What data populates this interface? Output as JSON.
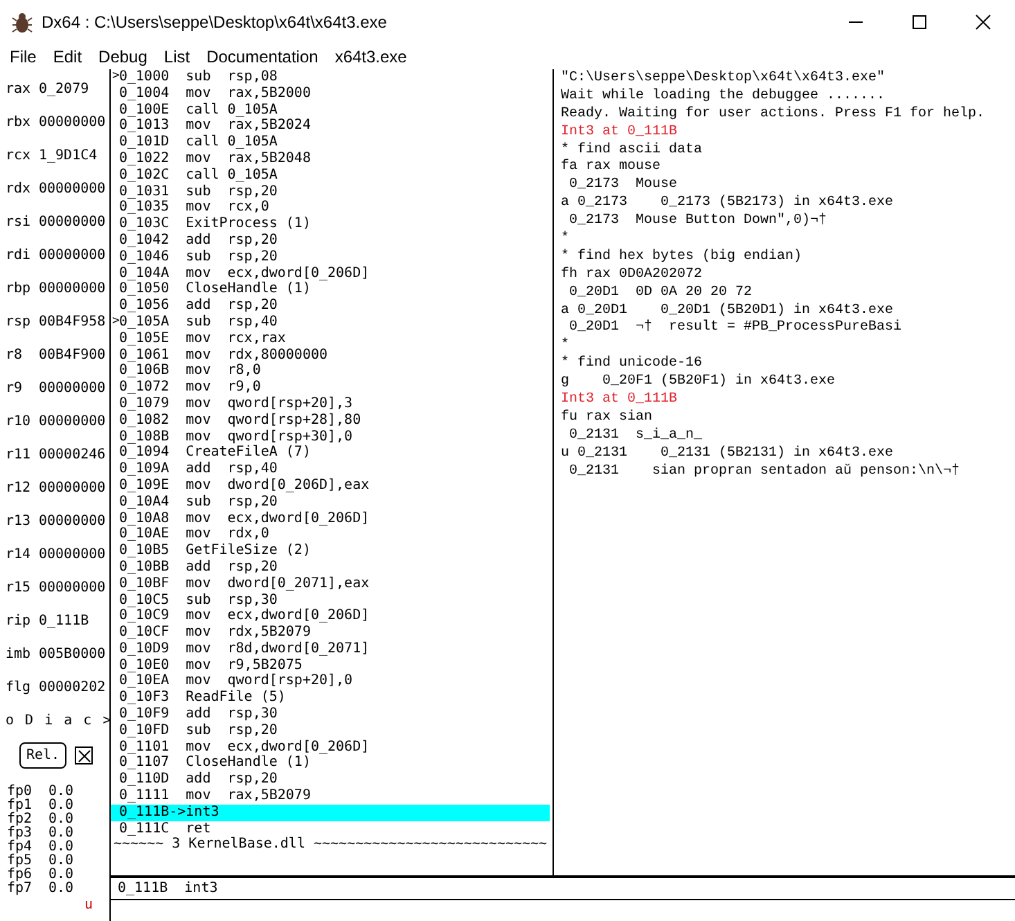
{
  "window": {
    "title": "Dx64 : C:\\Users\\seppe\\Desktop\\x64t\\x64t3.exe"
  },
  "menu": [
    "File",
    "Edit",
    "Debug",
    "List",
    "Documentation",
    "x64t3.exe"
  ],
  "registers": [
    {
      "name": "rax",
      "value": "0_2079"
    },
    {
      "name": "rbx",
      "value": "00000000"
    },
    {
      "name": "rcx",
      "value": "1_9D1C4"
    },
    {
      "name": "rdx",
      "value": "00000000"
    },
    {
      "name": "rsi",
      "value": "00000000"
    },
    {
      "name": "rdi",
      "value": "00000000"
    },
    {
      "name": "rbp",
      "value": "00000000"
    },
    {
      "name": "rsp",
      "value": "00B4F958"
    },
    {
      "name": "r8",
      "value": "00B4F900"
    },
    {
      "name": "r9",
      "value": "00000000"
    },
    {
      "name": "r10",
      "value": "00000000"
    },
    {
      "name": "r11",
      "value": "00000246"
    },
    {
      "name": "r12",
      "value": "00000000"
    },
    {
      "name": "r13",
      "value": "00000000"
    },
    {
      "name": "r14",
      "value": "00000000"
    },
    {
      "name": "r15",
      "value": "00000000"
    },
    {
      "name": "rip",
      "value": "0_111B"
    },
    {
      "name": "imb",
      "value": "005B0000"
    },
    {
      "name": "flg",
      "value": "00000202"
    }
  ],
  "flags": "o D i a c >",
  "rel_button": {
    "label": "Rel.",
    "checked": true
  },
  "fpu": [
    {
      "name": "fp0",
      "value": "0.0"
    },
    {
      "name": "fp1",
      "value": "0.0"
    },
    {
      "name": "fp2",
      "value": "0.0"
    },
    {
      "name": "fp3",
      "value": "0.0"
    },
    {
      "name": "fp4",
      "value": "0.0"
    },
    {
      "name": "fp5",
      "value": "0.0"
    },
    {
      "name": "fp6",
      "value": "0.0"
    },
    {
      "name": "fp7",
      "value": "0.0"
    }
  ],
  "mode_indicator": "u",
  "disassembly": [
    {
      "kind": "instr",
      "marker": ">",
      "text": "0_1000  sub  rsp,08",
      "selected": false
    },
    {
      "kind": "instr",
      "text": "0_1004  mov  rax,5B2000",
      "selected": false
    },
    {
      "kind": "instr",
      "text": "0_100E  call 0_105A",
      "selected": false
    },
    {
      "kind": "instr",
      "text": "0_1013  mov  rax,5B2024",
      "selected": false
    },
    {
      "kind": "instr",
      "text": "0_101D  call 0_105A",
      "selected": false
    },
    {
      "kind": "instr",
      "text": "0_1022  mov  rax,5B2048",
      "selected": false
    },
    {
      "kind": "instr",
      "text": "0_102C  call 0_105A",
      "selected": false
    },
    {
      "kind": "instr",
      "text": "0_1031  sub  rsp,20",
      "selected": false
    },
    {
      "kind": "instr",
      "text": "0_1035  mov  rcx,0",
      "selected": false
    },
    {
      "kind": "instr",
      "text": "0_103C  ExitProcess (1)",
      "selected": false
    },
    {
      "kind": "instr",
      "text": "0_1042  add  rsp,20",
      "selected": false
    },
    {
      "kind": "instr",
      "text": "0_1046  sub  rsp,20",
      "selected": false
    },
    {
      "kind": "instr",
      "text": "0_104A  mov  ecx,dword[0_206D]",
      "selected": false
    },
    {
      "kind": "instr",
      "text": "0_1050  CloseHandle (1)",
      "selected": false
    },
    {
      "kind": "instr",
      "text": "0_1056  add  rsp,20",
      "selected": false
    },
    {
      "kind": "instr",
      "marker": ">",
      "text": "0_105A  sub  rsp,40",
      "selected": false
    },
    {
      "kind": "instr",
      "text": "0_105E  mov  rcx,rax",
      "selected": false
    },
    {
      "kind": "instr",
      "text": "0_1061  mov  rdx,80000000",
      "selected": false
    },
    {
      "kind": "instr",
      "text": "0_106B  mov  r8,0",
      "selected": false
    },
    {
      "kind": "instr",
      "text": "0_1072  mov  r9,0",
      "selected": false
    },
    {
      "kind": "instr",
      "text": "0_1079  mov  qword[rsp+20],3",
      "selected": false
    },
    {
      "kind": "instr",
      "text": "0_1082  mov  qword[rsp+28],80",
      "selected": false
    },
    {
      "kind": "instr",
      "text": "0_108B  mov  qword[rsp+30],0",
      "selected": false
    },
    {
      "kind": "instr",
      "text": "0_1094  CreateFileA (7)",
      "selected": false
    },
    {
      "kind": "instr",
      "text": "0_109A  add  rsp,40",
      "selected": false
    },
    {
      "kind": "instr",
      "text": "0_109E  mov  dword[0_206D],eax",
      "selected": false
    },
    {
      "kind": "instr",
      "text": "0_10A4  sub  rsp,20",
      "selected": false
    },
    {
      "kind": "instr",
      "text": "0_10A8  mov  ecx,dword[0_206D]",
      "selected": false
    },
    {
      "kind": "instr",
      "text": "0_10AE  mov  rdx,0",
      "selected": false
    },
    {
      "kind": "instr",
      "text": "0_10B5  GetFileSize (2)",
      "selected": false
    },
    {
      "kind": "instr",
      "text": "0_10BB  add  rsp,20",
      "selected": false
    },
    {
      "kind": "instr",
      "text": "0_10BF  mov  dword[0_2071],eax",
      "selected": false
    },
    {
      "kind": "instr",
      "text": "0_10C5  sub  rsp,30",
      "selected": false
    },
    {
      "kind": "instr",
      "text": "0_10C9  mov  ecx,dword[0_206D]",
      "selected": false
    },
    {
      "kind": "instr",
      "text": "0_10CF  mov  rdx,5B2079",
      "selected": false
    },
    {
      "kind": "instr",
      "text": "0_10D9  mov  r8d,dword[0_2071]",
      "selected": false
    },
    {
      "kind": "instr",
      "text": "0_10E0  mov  r9,5B2075",
      "selected": false
    },
    {
      "kind": "instr",
      "text": "0_10EA  mov  qword[rsp+20],0",
      "selected": false
    },
    {
      "kind": "instr",
      "text": "0_10F3  ReadFile (5)",
      "selected": false
    },
    {
      "kind": "instr",
      "text": "0_10F9  add  rsp,30",
      "selected": false
    },
    {
      "kind": "instr",
      "text": "0_10FD  sub  rsp,20",
      "selected": false
    },
    {
      "kind": "instr",
      "text": "0_1101  mov  ecx,dword[0_206D]",
      "selected": false
    },
    {
      "kind": "instr",
      "text": "0_1107  CloseHandle (1)",
      "selected": false
    },
    {
      "kind": "instr",
      "text": "0_110D  add  rsp,20",
      "selected": false
    },
    {
      "kind": "instr",
      "text": "0_1111  mov  rax,5B2079",
      "selected": false
    },
    {
      "kind": "instr",
      "text": "0_111B->int3",
      "selected": true
    },
    {
      "kind": "instr",
      "text": "0_111C  ret",
      "selected": false
    },
    {
      "kind": "separator",
      "text": "~~~~~~ 3 KernelBase.dll ~~~~~~~~~~~~~~~~~~~~~~~~~~~~"
    }
  ],
  "console": [
    {
      "kind": "output",
      "text": "\"C:\\Users\\seppe\\Desktop\\x64t\\x64t3.exe\""
    },
    {
      "kind": "output",
      "text": "Wait while loading the debuggee ......."
    },
    {
      "kind": "output",
      "text": "Ready. Waiting for user actions. Press F1 for help."
    },
    {
      "kind": "event",
      "text": "Int3 at 0_111B"
    },
    {
      "kind": "output",
      "text": "* find ascii data"
    },
    {
      "kind": "output",
      "text": "fa rax mouse"
    },
    {
      "kind": "output",
      "text": " 0_2173  Mouse"
    },
    {
      "kind": "output",
      "text": "a 0_2173    0_2173 (5B2173) in x64t3.exe"
    },
    {
      "kind": "output",
      "text": " 0_2173  Mouse Button Down\",0)¬†"
    },
    {
      "kind": "output",
      "text": "*"
    },
    {
      "kind": "output",
      "text": "* find hex bytes (big endian)"
    },
    {
      "kind": "output",
      "text": "fh rax 0D0A202072"
    },
    {
      "kind": "output",
      "text": " 0_20D1  0D 0A 20 20 72"
    },
    {
      "kind": "output",
      "text": "a 0_20D1    0_20D1 (5B20D1) in x64t3.exe"
    },
    {
      "kind": "output",
      "text": " 0_20D1  ¬†  result = #PB_ProcessPureBasi"
    },
    {
      "kind": "output",
      "text": "*"
    },
    {
      "kind": "output",
      "text": "* find unicode-16"
    },
    {
      "kind": "output",
      "text": "g    0_20F1 (5B20F1) in x64t3.exe"
    },
    {
      "kind": "event",
      "text": "Int3 at 0_111B"
    },
    {
      "kind": "output",
      "text": "fu rax sian"
    },
    {
      "kind": "output",
      "text": " 0_2131  s_i_a_n_"
    },
    {
      "kind": "output",
      "text": "u 0_2131    0_2131 (5B2131) in x64t3.exe"
    },
    {
      "kind": "output",
      "text": " 0_2131    sian propran sentadon aŭ penson:\\n\\¬†"
    }
  ],
  "status_bar": {
    "text": "0_111B  int3"
  }
}
